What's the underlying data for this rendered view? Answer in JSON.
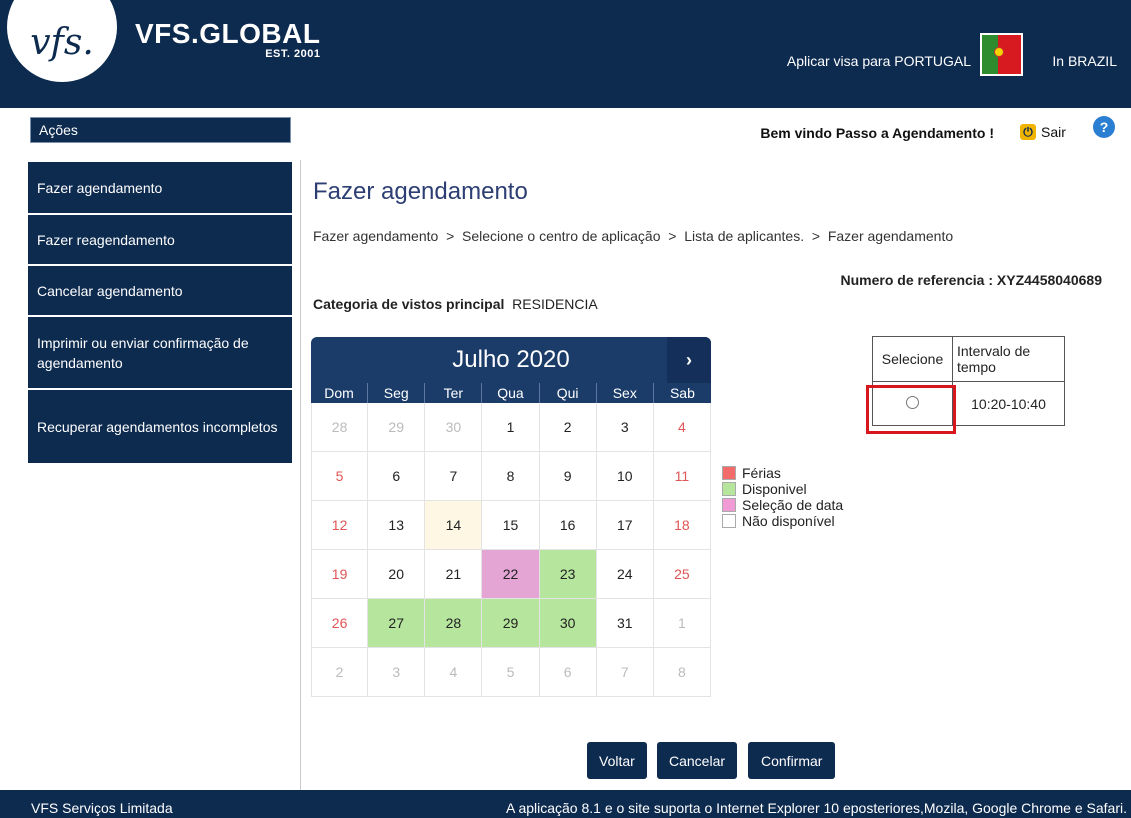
{
  "header": {
    "logo_text": "vfs.",
    "brand_name": "VFS.GLOBAL",
    "brand_est": "EST. 2001",
    "apply_text": "Aplicar visa para PORTUGAL",
    "country_text": "In BRAZIL"
  },
  "actions_bar": {
    "label": "Ações"
  },
  "user": {
    "welcome": "Bem vindo Passo a Agendamento !",
    "logout": "Sair",
    "help": "?"
  },
  "sidebar": {
    "items": [
      {
        "label": "Fazer agendamento"
      },
      {
        "label": "Fazer reagendamento"
      },
      {
        "label": "Cancelar agendamento"
      },
      {
        "label": "Imprimir ou enviar confirmação de agendamento"
      },
      {
        "label": "Recuperar agendamentos incompletos"
      }
    ]
  },
  "main": {
    "title": "Fazer agendamento",
    "breadcrumb": "Fazer agendamento  >  Selecione o centro de aplicação  >  Lista de aplicantes.  >  Fazer agendamento",
    "reference": "Numero de referencia : XYZ4458040689",
    "category_label": "Categoria de vistos principal",
    "category_value": "RESIDENCIA"
  },
  "calendar": {
    "month": "Julho 2020",
    "next": "›",
    "weekdays": [
      "Dom",
      "Seg",
      "Ter",
      "Qua",
      "Qui",
      "Sex",
      "Sab"
    ],
    "weeks": [
      [
        {
          "d": "28",
          "s": "muted"
        },
        {
          "d": "29",
          "s": "muted"
        },
        {
          "d": "30",
          "s": "muted"
        },
        {
          "d": "1",
          "s": ""
        },
        {
          "d": "2",
          "s": ""
        },
        {
          "d": "3",
          "s": ""
        },
        {
          "d": "4",
          "s": "weekend"
        }
      ],
      [
        {
          "d": "5",
          "s": "weekend"
        },
        {
          "d": "6",
          "s": ""
        },
        {
          "d": "7",
          "s": ""
        },
        {
          "d": "8",
          "s": ""
        },
        {
          "d": "9",
          "s": ""
        },
        {
          "d": "10",
          "s": ""
        },
        {
          "d": "11",
          "s": "weekend"
        }
      ],
      [
        {
          "d": "12",
          "s": "weekend"
        },
        {
          "d": "13",
          "s": ""
        },
        {
          "d": "14",
          "s": "today"
        },
        {
          "d": "15",
          "s": ""
        },
        {
          "d": "16",
          "s": ""
        },
        {
          "d": "17",
          "s": ""
        },
        {
          "d": "18",
          "s": "weekend"
        }
      ],
      [
        {
          "d": "19",
          "s": "weekend"
        },
        {
          "d": "20",
          "s": ""
        },
        {
          "d": "21",
          "s": ""
        },
        {
          "d": "22",
          "s": "selected"
        },
        {
          "d": "23",
          "s": "available"
        },
        {
          "d": "24",
          "s": ""
        },
        {
          "d": "25",
          "s": "weekend"
        }
      ],
      [
        {
          "d": "26",
          "s": "weekend"
        },
        {
          "d": "27",
          "s": "available"
        },
        {
          "d": "28",
          "s": "available"
        },
        {
          "d": "29",
          "s": "available"
        },
        {
          "d": "30",
          "s": "available"
        },
        {
          "d": "31",
          "s": ""
        },
        {
          "d": "1",
          "s": "muted"
        }
      ],
      [
        {
          "d": "2",
          "s": "muted"
        },
        {
          "d": "3",
          "s": "muted"
        },
        {
          "d": "4",
          "s": "muted"
        },
        {
          "d": "5",
          "s": "muted"
        },
        {
          "d": "6",
          "s": "muted"
        },
        {
          "d": "7",
          "s": "muted"
        },
        {
          "d": "8",
          "s": "muted"
        }
      ]
    ]
  },
  "legend": [
    {
      "label": "Férias",
      "color": "#f26b6b"
    },
    {
      "label": "Disponivel",
      "color": "#b6e59e"
    },
    {
      "label": "Seleção de data",
      "color": "#f29ad6"
    },
    {
      "label": "Não disponível",
      "color": "#ffffff"
    }
  ],
  "slots": {
    "col_select": "Selecione",
    "col_interval": "Intervalo de tempo",
    "rows": [
      {
        "interval": "10:20-10:40"
      }
    ]
  },
  "buttons": {
    "back": "Voltar",
    "cancel": "Cancelar",
    "confirm": "Confirmar"
  },
  "footer": {
    "left": "VFS Serviços Limitada",
    "right": "A aplicação 8.1 e o site suporta o Internet Explorer 10 eposteriores,Mozila, Google Chrome e Safari."
  }
}
